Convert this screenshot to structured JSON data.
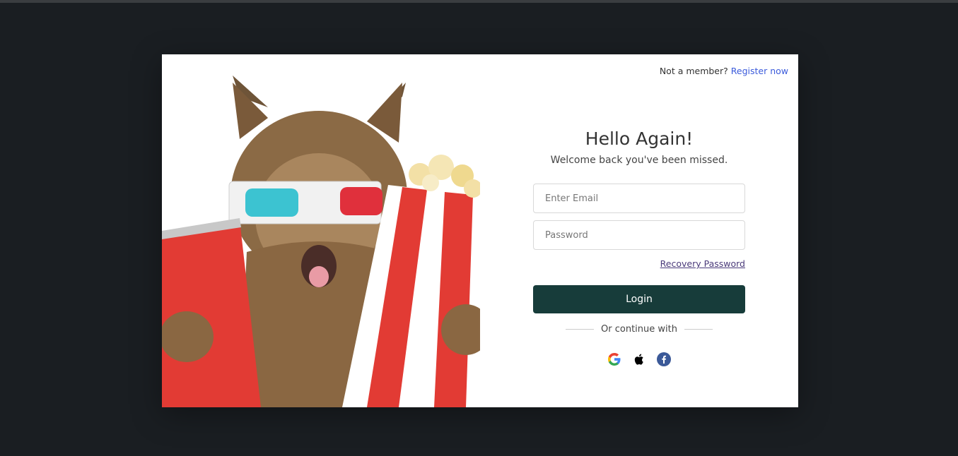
{
  "header": {
    "prompt": "Not a member?",
    "register_link": "Register now"
  },
  "form": {
    "title": "Hello Again!",
    "subtitle": "Welcome back you've been missed.",
    "email_placeholder": "Enter Email",
    "password_placeholder": "Password",
    "recovery_link": "Recovery Password",
    "login_label": "Login",
    "divider_text": "Or continue with"
  },
  "socials": [
    {
      "name": "google-icon"
    },
    {
      "name": "apple-icon"
    },
    {
      "name": "facebook-icon"
    }
  ],
  "colors": {
    "page_bg": "#1a1e22",
    "card_bg": "#ffffff",
    "login_button": "#173c3a",
    "link": "#3b5bdb"
  }
}
